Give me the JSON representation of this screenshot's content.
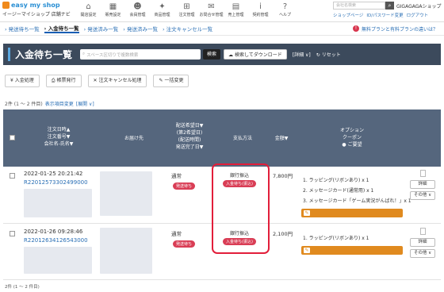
{
  "logo": {
    "brand": "easy my shop",
    "sub": "イージーマイショップ 店舗ナビ"
  },
  "topnav": [
    {
      "icon": "home-icon",
      "glyph": "⌂",
      "label": "開店設定"
    },
    {
      "icon": "shop-icon",
      "glyph": "▦",
      "label": "販売設定"
    },
    {
      "icon": "users-icon",
      "glyph": "☻",
      "label": "会員管理"
    },
    {
      "icon": "gift-icon",
      "glyph": "✦",
      "label": "商品管理"
    },
    {
      "icon": "cart-icon",
      "glyph": "⊞",
      "label": "注文管理"
    },
    {
      "icon": "mail-icon",
      "glyph": "✉",
      "label": "お問合せ管理"
    },
    {
      "icon": "calc-icon",
      "glyph": "▤",
      "label": "売上管理"
    },
    {
      "icon": "info-icon",
      "glyph": "i",
      "label": "契約管理"
    },
    {
      "icon": "help-icon",
      "glyph": "?",
      "label": "ヘルプ"
    }
  ],
  "search": {
    "placeholder": "会社名検索",
    "shop_name": "GIGAGAGAショップ"
  },
  "toplinks": [
    "ショップページ",
    "ID/パスワード変更",
    "ログアウト"
  ],
  "subnav": {
    "tabs": [
      "発送待ち一覧",
      "入金待ち一覧",
      "発送済み一覧",
      "発送済み一覧",
      "注文キャンセル一覧"
    ],
    "notice": "無料プランと有料プランの違いは？"
  },
  "page": {
    "title": "入金待ち一覧",
    "search_placeholder": "スペース区切りで複数検索",
    "search_button": "検索",
    "download_button": "検索してダウンロード",
    "detail_link": "[詳細 ∨]",
    "reset_link": "リセット"
  },
  "actions": [
    "入金処理",
    "帳票発行",
    "注文キャンセル処理",
    "一括変更"
  ],
  "count": {
    "text": "2件 (1 ～ 2 件目)",
    "link1": "表示項目変更",
    "link2": "[展開 ∨]"
  },
  "table": {
    "h_order": [
      "注文日時▲",
      "注文番号▼",
      "会社名-氏名▼"
    ],
    "h_ship": "お届け先",
    "h_delivery": [
      "配送希望日▼",
      "(第2希望日)",
      "(配送時間)",
      "発送完了日▼"
    ],
    "h_pay": "支払方法",
    "h_amount": "金額▼",
    "h_option": [
      "オプション",
      "クーポン",
      "ご要望"
    ]
  },
  "rows": [
    {
      "date": "2022-01-25 20:21:42",
      "order_id": "R22012573302499000",
      "ship_type": "通常",
      "ship_badge": "発送待ち",
      "pay": "銀行振込",
      "pay_badge": "入金待ち(振込)",
      "amount": "7,800円",
      "options": [
        "1. ラッピング(リボンあり) x 1",
        "2. メッセージカード(通常用) x 1",
        "3. メッセージカード「ゲーム実況がんばれ！」x 1"
      ],
      "btn1": "詳細",
      "btn2": "その他 ∨"
    },
    {
      "date": "2022-01-26 09:28:46",
      "order_id": "R22012634126543000",
      "ship_type": "通常",
      "ship_badge": "発送待ち",
      "pay": "銀行振込",
      "pay_badge": "入金待ち(振込)",
      "amount": "2,100円",
      "options": [
        "1. ラッピング(リボンあり) x 1"
      ],
      "btn1": "詳細",
      "btn2": "その他 ∨"
    }
  ],
  "footer": "2件 (1 ～ 2 件目)",
  "colors": {
    "header": "#3c4a5c",
    "table_head": "#55667d",
    "badge": "#d93d55",
    "option_bar": "#e08a1f",
    "highlight": "#e21e3a"
  }
}
